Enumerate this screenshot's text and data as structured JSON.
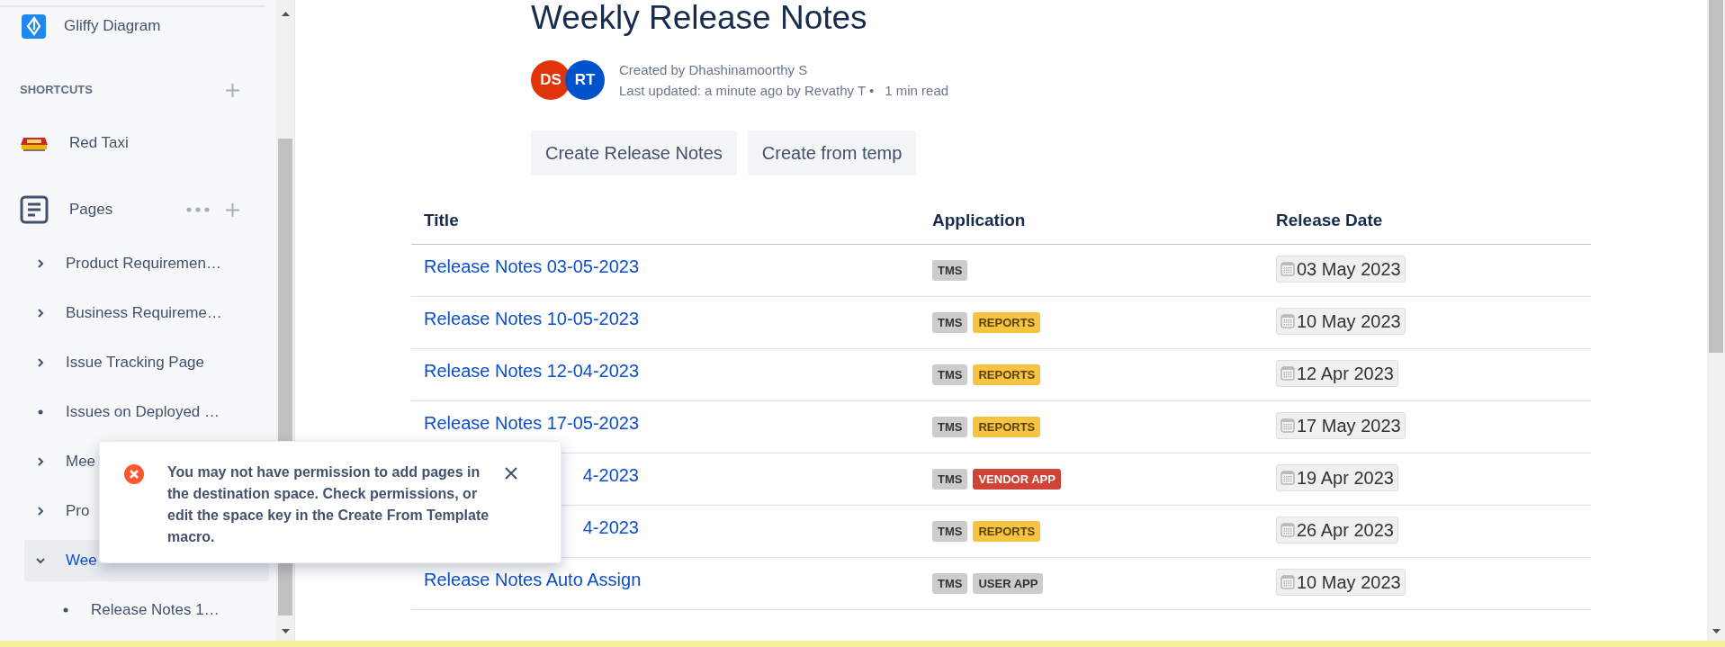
{
  "sidebar": {
    "app_link": {
      "label": "Gliffy Diagram"
    },
    "shortcuts": {
      "heading": "SHORTCUTS",
      "items": [
        {
          "label": "Red Taxi"
        }
      ]
    },
    "pages": {
      "heading": "Pages",
      "items": [
        {
          "label": "Product Requiremen…",
          "kind": "branch",
          "expanded": false,
          "selected": false
        },
        {
          "label": "Business Requireme…",
          "kind": "branch",
          "expanded": false,
          "selected": false
        },
        {
          "label": "Issue Tracking Page",
          "kind": "branch",
          "expanded": false,
          "selected": false
        },
        {
          "label": "Issues on Deployed …",
          "kind": "leaf",
          "selected": false
        },
        {
          "label": "Mee",
          "kind": "branch",
          "expanded": false,
          "selected": false
        },
        {
          "label": "Pro",
          "kind": "branch",
          "expanded": false,
          "selected": false
        },
        {
          "label": "Wee",
          "kind": "branch",
          "expanded": true,
          "selected": true,
          "children": [
            {
              "label": "Release Notes 1…",
              "kind": "leaf",
              "selected": false
            }
          ]
        }
      ]
    }
  },
  "page": {
    "title": "Weekly Release Notes",
    "avatars": [
      {
        "initials": "DS",
        "color": "#de350b"
      },
      {
        "initials": "RT",
        "color": "#0052cc"
      }
    ],
    "created": "Created by Dhashinamoorthy S",
    "updated": "Last updated: a minute ago by Revathy T •",
    "read_time": "1 min read",
    "buttons": [
      "Create Release Notes",
      "Create from temp"
    ]
  },
  "table": {
    "columns": [
      "Title",
      "Application",
      "Release Date"
    ],
    "rows": [
      {
        "title": "Release Notes 03-05-2023",
        "apps": [
          {
            "label": "TMS",
            "color": "#cccccc"
          }
        ],
        "date": "03 May 2023"
      },
      {
        "title": "Release Notes 10-05-2023",
        "apps": [
          {
            "label": "TMS",
            "color": "#cccccc"
          },
          {
            "label": "REPORTS",
            "color": "#f6c342"
          }
        ],
        "date": "10 May 2023"
      },
      {
        "title": "Release Notes 12-04-2023",
        "apps": [
          {
            "label": "TMS",
            "color": "#cccccc"
          },
          {
            "label": "REPORTS",
            "color": "#f6c342"
          }
        ],
        "date": "12 Apr 2023"
      },
      {
        "title": "Release Notes 17-05-2023",
        "apps": [
          {
            "label": "TMS",
            "color": "#cccccc"
          },
          {
            "label": "REPORTS",
            "color": "#f6c342"
          }
        ],
        "date": "17 May 2023"
      },
      {
        "title": "4-2023",
        "apps": [
          {
            "label": "TMS",
            "color": "#cccccc"
          },
          {
            "label": "VENDOR APP",
            "color": "#d04437"
          }
        ],
        "date": "19 Apr 2023"
      },
      {
        "title": "4-2023",
        "apps": [
          {
            "label": "TMS",
            "color": "#cccccc"
          },
          {
            "label": "REPORTS",
            "color": "#f6c342"
          }
        ],
        "date": "26 Apr 2023"
      },
      {
        "title": "Release Notes Auto Assign",
        "apps": [
          {
            "label": "TMS",
            "color": "#cccccc"
          },
          {
            "label": "USER APP",
            "color": "#cccccc"
          }
        ],
        "date": "10 May 2023"
      }
    ]
  },
  "toast": {
    "kind": "error",
    "message": "You may not have permission to add pages in the destination space. Check permissions, or edit the space key in the Create From Template macro."
  }
}
